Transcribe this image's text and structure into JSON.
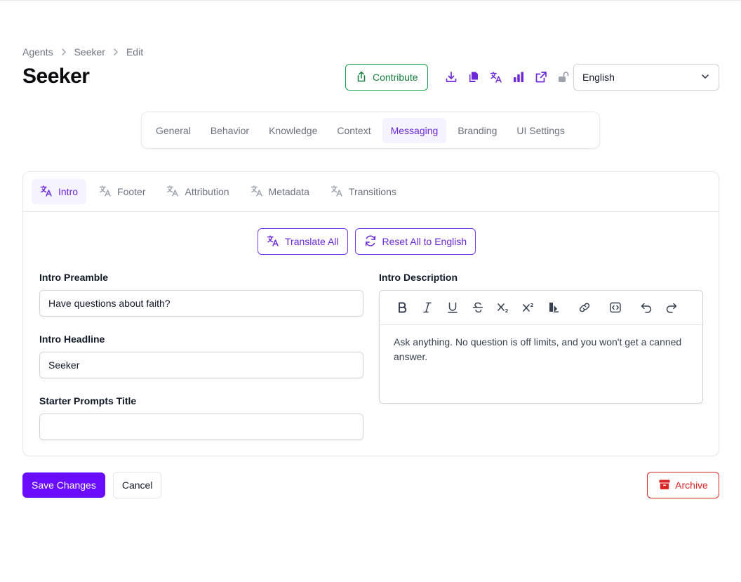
{
  "breadcrumb": [
    "Agents",
    "Seeker",
    "Edit"
  ],
  "page_title": "Seeker",
  "header": {
    "contribute_label": "Contribute",
    "icons": [
      "download-icon",
      "copy-icon",
      "translate-icon",
      "bar-chart-icon",
      "external-link-icon",
      "unlock-icon"
    ],
    "language_value": "English"
  },
  "main_tabs": [
    "General",
    "Behavior",
    "Knowledge",
    "Context",
    "Messaging",
    "Branding",
    "UI Settings"
  ],
  "main_tabs_active": "Messaging",
  "sub_tabs": [
    "Intro",
    "Footer",
    "Attribution",
    "Metadata",
    "Transitions"
  ],
  "sub_tabs_active": "Intro",
  "actions": {
    "translate_all": "Translate All",
    "reset_all": "Reset All to English"
  },
  "form": {
    "preamble_label": "Intro Preamble",
    "preamble_value": "Have questions about faith?",
    "headline_label": "Intro Headline",
    "headline_value": "Seeker",
    "starter_label": "Starter Prompts Title",
    "starter_value": "",
    "description_label": "Intro Description",
    "description_value": "Ask anything. No question is off limits, and you won't get a canned answer."
  },
  "editor_toolbar": [
    "bold-icon",
    "italic-icon",
    "underline-icon",
    "strikethrough-icon",
    "subscript-icon",
    "superscript-icon",
    "highlight-icon",
    "link-icon",
    "code-icon",
    "undo-icon",
    "redo-icon"
  ],
  "footer": {
    "save_label": "Save Changes",
    "cancel_label": "Cancel",
    "archive_label": "Archive"
  },
  "colors": {
    "accent": "#6d28d9",
    "success": "#15803d",
    "danger": "#dc2626"
  }
}
